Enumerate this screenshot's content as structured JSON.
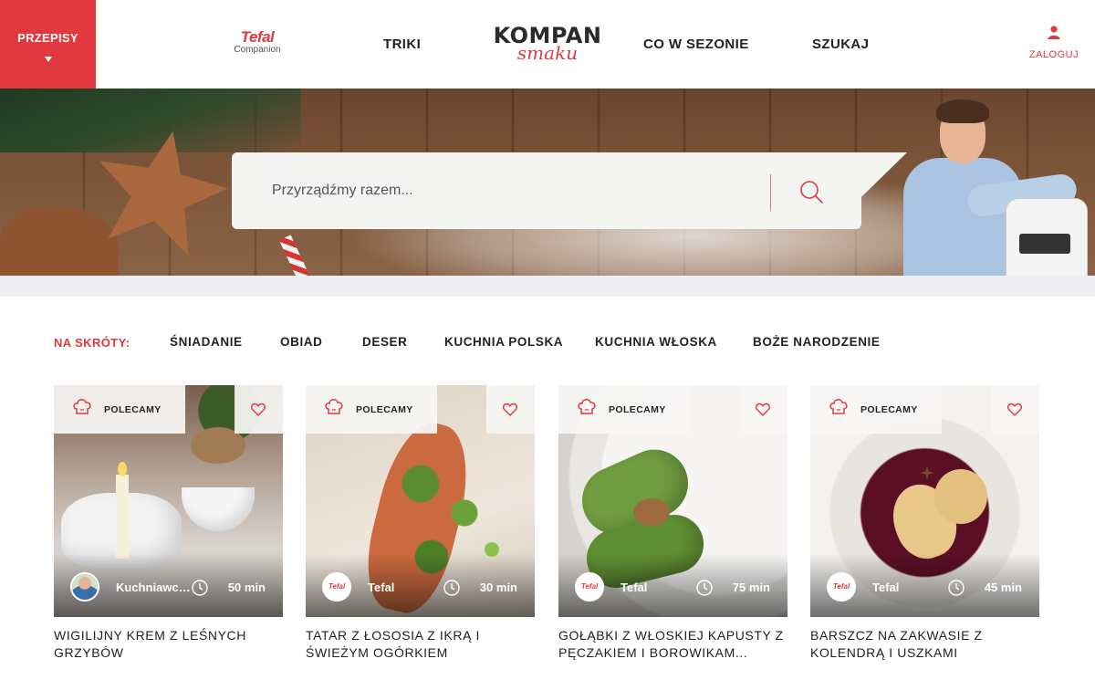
{
  "header": {
    "menu_label": "PRZEPISY",
    "tefal_logo": {
      "brand": "Tefal",
      "sub": "Companion"
    },
    "nav": [
      "TRIKI",
      "CO W SEZONIE",
      "SZUKAJ"
    ],
    "site_logo": {
      "line1": "KOMPAN",
      "line2": "smaku"
    },
    "login_label": "ZALOGUJ"
  },
  "hero": {
    "search_placeholder": "Przyrządźmy razem..."
  },
  "shortcuts": {
    "label": "NA SKRÓTY:",
    "items": [
      "ŚNIADANIE",
      "OBIAD",
      "DESER",
      "KUCHNIA POLSKA",
      "KUCHNIA WŁOSKA",
      "BOŻE NARODZENIE"
    ]
  },
  "cards": [
    {
      "badge": "POLECAMY",
      "author": "Kuchniawcz...",
      "time": "50 min",
      "title": "WIGILIJNY KREM Z LEŚNYCH GRZYBÓW"
    },
    {
      "badge": "POLECAMY",
      "author": "Tefal",
      "author_logo": "Tefal",
      "time": "30 min",
      "title": "TATAR Z ŁOSOSIA Z IKRĄ I ŚWIEŻYM OGÓRKIEM"
    },
    {
      "badge": "POLECAMY",
      "author": "Tefal",
      "author_logo": "Tefal",
      "time": "75 min",
      "title": "GOŁĄBKI Z WŁOSKIEJ KAPUSTY Z PĘCZAKIEM I BOROWIKAM..."
    },
    {
      "badge": "POLECAMY",
      "author": "Tefal",
      "author_logo": "Tefal",
      "time": "45 min",
      "title": "BARSZCZ NA ZAKWASIE Z KOLENDRĄ I USZKAMI"
    }
  ],
  "icons": {
    "menu_caret": "caret-down-icon",
    "login": "user-icon",
    "search": "search-icon",
    "badge": "chef-hat-icon",
    "favorite": "heart-icon",
    "time": "clock-icon"
  },
  "colors": {
    "accent": "#e2383f",
    "text": "#222222",
    "search_bg": "#f4f4f3"
  }
}
